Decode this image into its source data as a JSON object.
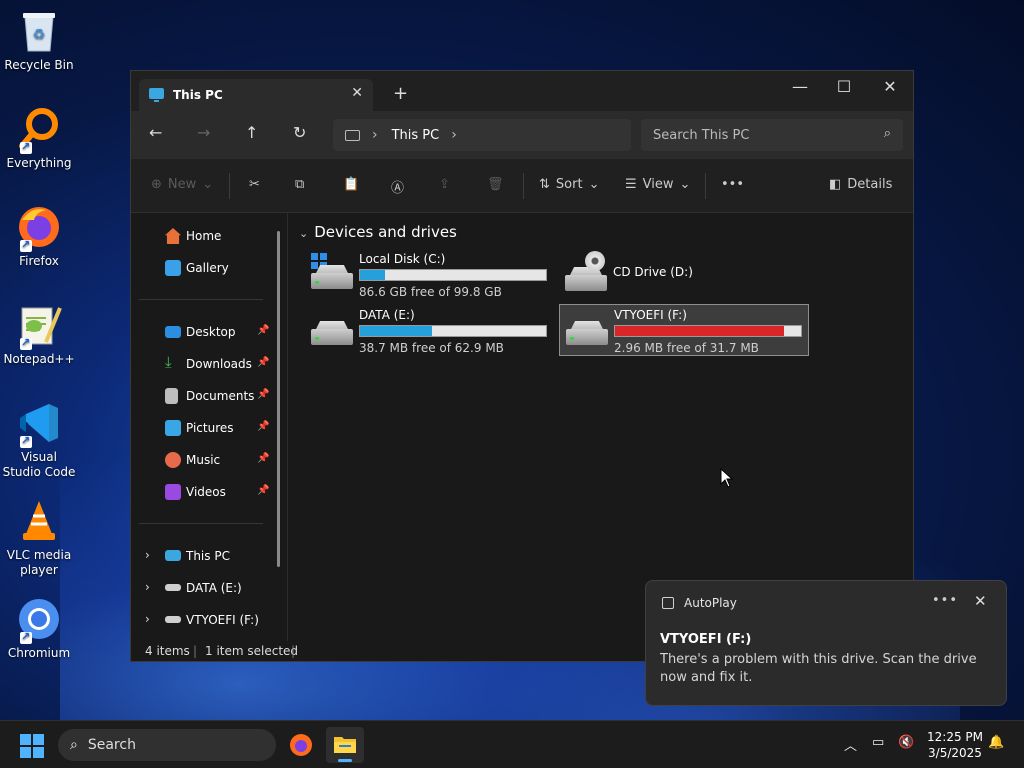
{
  "desktop": {
    "icons": [
      {
        "label": "Recycle Bin",
        "icon": "recycle-bin-icon"
      },
      {
        "label": "Everything",
        "icon": "everything-icon"
      },
      {
        "label": "Firefox",
        "icon": "firefox-icon"
      },
      {
        "label": "Notepad++",
        "icon": "notepad-plus-plus-icon"
      },
      {
        "label": "Visual Studio Code",
        "icon": "vscode-icon"
      },
      {
        "label": "VLC media player",
        "icon": "vlc-icon"
      },
      {
        "label": "Chromium",
        "icon": "chromium-icon"
      }
    ]
  },
  "window": {
    "tab_title": "This PC",
    "new_tab": "+",
    "controls": {
      "minimize": "—",
      "maximize": "☐",
      "close": "✕"
    }
  },
  "navbar": {
    "crumb": "This PC",
    "search_placeholder": "Search This PC"
  },
  "toolbar": {
    "new_label": "New",
    "sort_label": "Sort",
    "view_label": "View",
    "more_label": "•••",
    "details_label": "Details"
  },
  "nav_pane": {
    "items": [
      {
        "label": "Home",
        "icon": "home-icon"
      },
      {
        "label": "Gallery",
        "icon": "gallery-icon"
      },
      {
        "label": "Desktop",
        "icon": "desktop-icon",
        "pinned": true
      },
      {
        "label": "Downloads",
        "icon": "downloads-icon",
        "pinned": true
      },
      {
        "label": "Documents",
        "icon": "documents-icon",
        "pinned": true
      },
      {
        "label": "Pictures",
        "icon": "pictures-icon",
        "pinned": true
      },
      {
        "label": "Music",
        "icon": "music-icon",
        "pinned": true
      },
      {
        "label": "Videos",
        "icon": "videos-icon",
        "pinned": true
      },
      {
        "label": "This PC",
        "icon": "this-pc-icon"
      },
      {
        "label": "DATA (E:)",
        "icon": "drive-icon"
      },
      {
        "label": "VTYOEFI (F:)",
        "icon": "drive-icon"
      }
    ]
  },
  "content": {
    "group_title": "Devices and drives",
    "drives": [
      {
        "name": "Local Disk (C:)",
        "free": "86.6 GB free of 99.8 GB",
        "used_fraction": 0.132,
        "bar_color": "#26a0da"
      },
      {
        "name": "CD Drive (D:)"
      },
      {
        "name": "DATA (E:)",
        "free": "38.7 MB free of 62.9 MB",
        "used_fraction": 0.385,
        "bar_color": "#26a0da"
      },
      {
        "name": "VTYOEFI (F:)",
        "free": "2.96 MB free of 31.7 MB",
        "used_fraction": 0.907,
        "bar_color": "#da2626",
        "selected": true
      }
    ]
  },
  "status": {
    "count": "4 items",
    "selection": "1 item selected"
  },
  "toast": {
    "app": "AutoPlay",
    "title": "VTYOEFI (F:)",
    "message": "There's a problem with this drive.  Scan the drive now and fix it."
  },
  "taskbar": {
    "search_label": "Search",
    "time": "12:25 PM",
    "date": "3/5/2025"
  }
}
